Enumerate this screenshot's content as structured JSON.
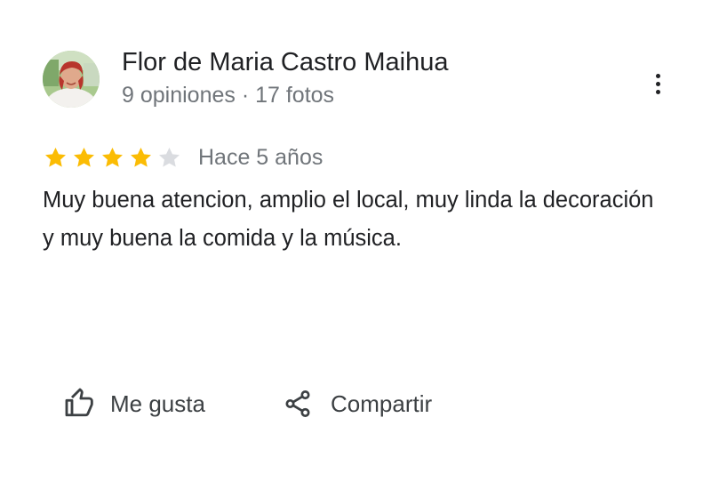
{
  "review": {
    "author": {
      "name": "Flor de Maria Castro Maihua",
      "meta": "9 opiniones · 17 fotos",
      "avatar_icon": "user-photo-avatar"
    },
    "rating": 4,
    "rating_max": 5,
    "date": "Hace 5 años",
    "text": "Muy buena atencion, amplio el local, muy linda la decoración y muy buena la comida y la música.",
    "colors": {
      "star_filled": "#fbbc04",
      "star_empty": "#dadce0",
      "text": "#202124",
      "meta": "#70757a"
    }
  },
  "actions": {
    "like_label": "Me gusta",
    "like_icon": "thumbs-up-icon",
    "share_label": "Compartir",
    "share_icon": "share-icon",
    "more_icon": "more-vert-icon"
  }
}
